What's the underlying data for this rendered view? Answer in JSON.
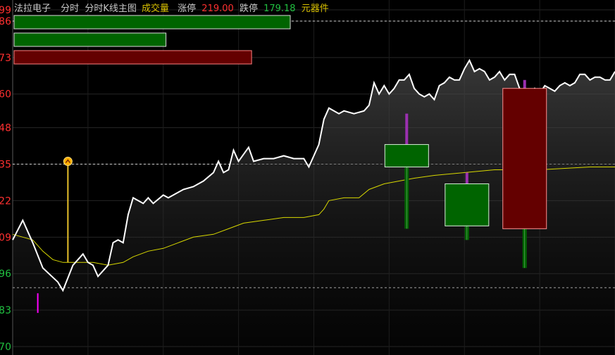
{
  "header": {
    "stock_name": "法拉电子",
    "mode_label": "分时",
    "indicator_label": "分时K线主图",
    "volume_label": "成交量",
    "limit_up_label": "涨停",
    "limit_up_value": "219.00",
    "limit_down_label": "跌停",
    "limit_down_value": "179.18",
    "component_label": "元器件"
  },
  "colors": {
    "background": "#000000",
    "price_line": "#ffffff",
    "avg_line": "#d8d800",
    "up_red": "#ff3030",
    "down_green": "#20c040",
    "bull_fill": "#006400",
    "bear_fill": "#640000",
    "wick_up": "#9b30b0",
    "header_gray": "#c8c8c8",
    "header_yellow": "#d8c000"
  },
  "chart_data": {
    "type": "line",
    "y_ticks": [
      {
        "label": "99",
        "value": 199.0,
        "color": "red"
      },
      {
        "label": "86",
        "value": 198.6,
        "color": "red"
      },
      {
        "label": "73",
        "value": 197.3,
        "color": "red"
      },
      {
        "label": "60",
        "value": 196.0,
        "color": "red"
      },
      {
        "label": "48",
        "value": 194.8,
        "color": "red"
      },
      {
        "label": "35",
        "value": 193.5,
        "color": "red"
      },
      {
        "label": "22",
        "value": 192.2,
        "color": "red"
      },
      {
        "label": "09",
        "value": 190.9,
        "color": "red"
      },
      {
        "label": "96",
        "value": 189.6,
        "color": "green"
      },
      {
        "label": "83",
        "value": 188.3,
        "color": "green"
      },
      {
        "label": "70",
        "value": 187.0,
        "color": "green"
      }
    ],
    "ylim": [
      186.7,
      199.35
    ],
    "xlim": [
      0,
      120
    ],
    "reference_lines": [
      198.6,
      193.5,
      189.1
    ],
    "volume_bars": [
      {
        "value": 1.0,
        "color": "green"
      },
      {
        "value": 0.55,
        "color": "green"
      },
      {
        "value": 0.86,
        "color": "red"
      }
    ],
    "series": [
      {
        "type": "price",
        "points": [
          [
            0,
            190.8
          ],
          [
            2,
            191.5
          ],
          [
            4,
            190.7
          ],
          [
            6,
            189.8
          ],
          [
            9,
            189.3
          ],
          [
            10,
            189.0
          ],
          [
            12,
            189.9
          ],
          [
            14,
            190.3
          ],
          [
            15,
            190.0
          ],
          [
            16,
            189.9
          ],
          [
            17,
            189.5
          ],
          [
            19,
            189.9
          ],
          [
            20,
            190.7
          ],
          [
            21,
            190.8
          ],
          [
            22,
            190.7
          ],
          [
            23,
            191.7
          ],
          [
            24,
            192.3
          ],
          [
            26,
            192.1
          ],
          [
            27,
            192.3
          ],
          [
            28,
            192.1
          ],
          [
            30,
            192.4
          ],
          [
            31,
            192.3
          ],
          [
            33,
            192.5
          ],
          [
            34,
            192.6
          ],
          [
            36,
            192.7
          ],
          [
            38,
            192.9
          ],
          [
            40,
            193.2
          ],
          [
            41,
            193.6
          ],
          [
            42,
            193.2
          ],
          [
            43,
            193.3
          ],
          [
            44,
            194.0
          ],
          [
            45,
            193.6
          ],
          [
            47,
            194.1
          ],
          [
            48,
            193.6
          ],
          [
            50,
            193.7
          ],
          [
            52,
            193.7
          ],
          [
            54,
            193.8
          ],
          [
            56,
            193.7
          ],
          [
            58,
            193.7
          ],
          [
            59,
            193.4
          ],
          [
            61,
            194.2
          ],
          [
            62,
            195.1
          ],
          [
            63,
            195.5
          ],
          [
            65,
            195.3
          ],
          [
            66,
            195.4
          ],
          [
            68,
            195.3
          ],
          [
            70,
            195.4
          ],
          [
            71,
            195.6
          ],
          [
            72,
            196.4
          ],
          [
            73,
            196.0
          ],
          [
            74,
            196.3
          ],
          [
            75,
            196.0
          ],
          [
            76,
            196.2
          ],
          [
            77,
            196.5
          ],
          [
            78,
            196.5
          ],
          [
            79,
            196.7
          ],
          [
            80,
            196.2
          ],
          [
            81,
            196.0
          ],
          [
            82,
            195.9
          ],
          [
            83,
            196.0
          ],
          [
            84,
            195.8
          ],
          [
            85,
            196.3
          ],
          [
            86,
            196.4
          ],
          [
            87,
            196.6
          ],
          [
            88,
            196.5
          ],
          [
            89,
            196.5
          ],
          [
            90,
            196.9
          ],
          [
            91,
            197.2
          ],
          [
            92,
            196.8
          ],
          [
            93,
            196.9
          ],
          [
            94,
            196.8
          ],
          [
            95,
            196.5
          ],
          [
            96,
            196.6
          ],
          [
            97,
            196.8
          ],
          [
            98,
            196.5
          ],
          [
            99,
            196.7
          ],
          [
            100,
            196.7
          ],
          [
            101,
            196.2
          ],
          [
            102,
            195.9
          ],
          [
            103,
            196.0
          ],
          [
            104,
            196.2
          ],
          [
            105,
            196.0
          ],
          [
            106,
            196.3
          ],
          [
            107,
            196.2
          ],
          [
            108,
            196.1
          ],
          [
            109,
            196.3
          ],
          [
            110,
            196.4
          ],
          [
            111,
            196.3
          ],
          [
            112,
            196.4
          ],
          [
            113,
            196.7
          ],
          [
            114,
            196.7
          ],
          [
            115,
            196.5
          ],
          [
            116,
            196.6
          ],
          [
            117,
            196.6
          ],
          [
            118,
            196.5
          ],
          [
            119,
            196.5
          ],
          [
            120,
            196.8
          ]
        ]
      },
      {
        "type": "average",
        "points": [
          [
            0,
            191.0
          ],
          [
            2,
            190.9
          ],
          [
            4,
            190.8
          ],
          [
            6,
            190.4
          ],
          [
            8,
            190.1
          ],
          [
            10,
            190.0
          ],
          [
            13,
            190.0
          ],
          [
            16,
            190.0
          ],
          [
            19,
            189.9
          ],
          [
            22,
            190.0
          ],
          [
            24,
            190.2
          ],
          [
            27,
            190.4
          ],
          [
            30,
            190.5
          ],
          [
            33,
            190.7
          ],
          [
            36,
            190.9
          ],
          [
            40,
            191.0
          ],
          [
            43,
            191.2
          ],
          [
            46,
            191.4
          ],
          [
            50,
            191.5
          ],
          [
            54,
            191.6
          ],
          [
            58,
            191.6
          ],
          [
            61,
            191.7
          ],
          [
            62,
            191.9
          ],
          [
            63,
            192.2
          ],
          [
            66,
            192.3
          ],
          [
            69,
            192.3
          ],
          [
            71,
            192.6
          ],
          [
            74,
            192.8
          ],
          [
            77,
            192.9
          ],
          [
            80,
            193.0
          ],
          [
            84,
            193.1
          ],
          [
            90,
            193.2
          ],
          [
            96,
            193.3
          ],
          [
            100,
            193.3
          ],
          [
            105,
            193.3
          ],
          [
            110,
            193.35
          ],
          [
            115,
            193.4
          ],
          [
            120,
            193.4
          ]
        ]
      }
    ],
    "candles": [
      {
        "x": 78.5,
        "open": 193.4,
        "close": 194.2,
        "high": 195.3,
        "low": 191.2,
        "direction": "down"
      },
      {
        "x": 90.5,
        "open": 192.8,
        "close": 191.3,
        "high": 193.2,
        "low": 190.8,
        "direction": "down"
      },
      {
        "x": 102,
        "open": 191.2,
        "close": 196.2,
        "high": 196.5,
        "low": 189.8,
        "direction": "up"
      }
    ],
    "markers": [
      {
        "type": "buy",
        "x": 11,
        "value": 193.6,
        "base": 190.0,
        "color": "#e6c02a"
      },
      {
        "type": "spike",
        "x": 5,
        "top": 188.9,
        "bottom": 188.2,
        "color": "#ff00ff"
      }
    ]
  }
}
